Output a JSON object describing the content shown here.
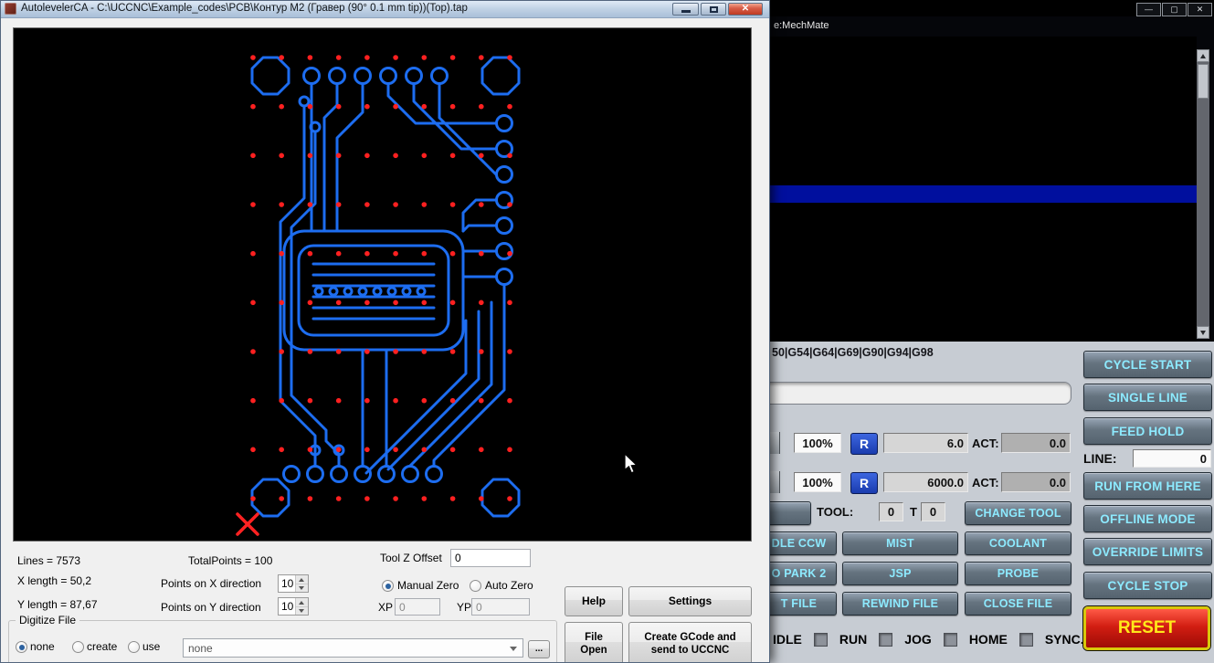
{
  "autoleveler": {
    "title": "AutolevelerCA - C:\\UCCNC\\Example_codes\\PCB\\Контур M2 (Гравер (90° 0.1 mm tip))(Top).tap",
    "stats": {
      "lines": "Lines =  7573",
      "total_points": "TotalPoints = 100",
      "x_length": "X length = 50,2",
      "y_length": "Y length = 87,67"
    },
    "points_x": {
      "label": "Points on X direction",
      "value": "10"
    },
    "points_y": {
      "label": "Points on Y direction",
      "value": "10"
    },
    "tool_z": {
      "label": "Tool Z Offset",
      "value": "0"
    },
    "zero_mode": {
      "manual": "Manual Zero",
      "auto": "Auto Zero"
    },
    "xp": {
      "label": "XP",
      "value": "0"
    },
    "yp": {
      "label": "YP",
      "value": "0"
    },
    "digitize": {
      "title": "Digitize File",
      "option_none": "none",
      "option_create": "create",
      "option_use": "use",
      "dropdown_value": "none",
      "browse": "..."
    },
    "buttons": {
      "help": "Help",
      "settings": "Settings",
      "file_open_line1": "File",
      "file_open_line2": "Open",
      "create_line1": "Create GCode and",
      "create_line2": "send to UCCNC"
    }
  },
  "uccnc": {
    "profile": "e:MechMate",
    "modal_status": "50|G54|G64|G69|G90|G94|G98",
    "side": {
      "cycle_start": "CYCLE START",
      "single_line": "SINGLE LINE",
      "feed_hold": "FEED HOLD",
      "line_label": "LINE:",
      "line_value": "0",
      "run_from_here": "RUN FROM HERE",
      "offline_mode": "OFFLINE MODE",
      "override_limits": "OVERRIDE LIMITS",
      "cycle_stop": "CYCLE STOP",
      "reset": "RESET"
    },
    "feed": {
      "override": "100%",
      "reset": "R",
      "set_value": "6.0",
      "act_label": "ACT:",
      "act_value": "0.0"
    },
    "spindle": {
      "override": "100%",
      "reset": "R",
      "set_value": "6000.0",
      "act_label": "ACT:",
      "act_value": "0.0"
    },
    "tool": {
      "label": "TOOL:",
      "value": "0",
      "t_label": "T",
      "t_value": "0",
      "change": "CHANGE TOOL"
    },
    "grid": {
      "spindle_ccw": "DLE CCW",
      "mist": "MIST",
      "coolant": "COOLANT",
      "goto_park2": "O PARK 2",
      "jsp": "JSP",
      "probe": "PROBE",
      "edit_file": "T FILE",
      "rewind_file": "REWIND FILE",
      "close_file": "CLOSE FILE"
    },
    "status": {
      "idle": "IDLE",
      "run": "RUN",
      "jog": "JOG",
      "home": "HOME",
      "sync": "SYNC."
    },
    "colors": {
      "accent_text": "#8deaff",
      "reset_bg": "#c01410",
      "reset_text": "#ffe81a",
      "highlight_line": "#000f9e"
    }
  }
}
